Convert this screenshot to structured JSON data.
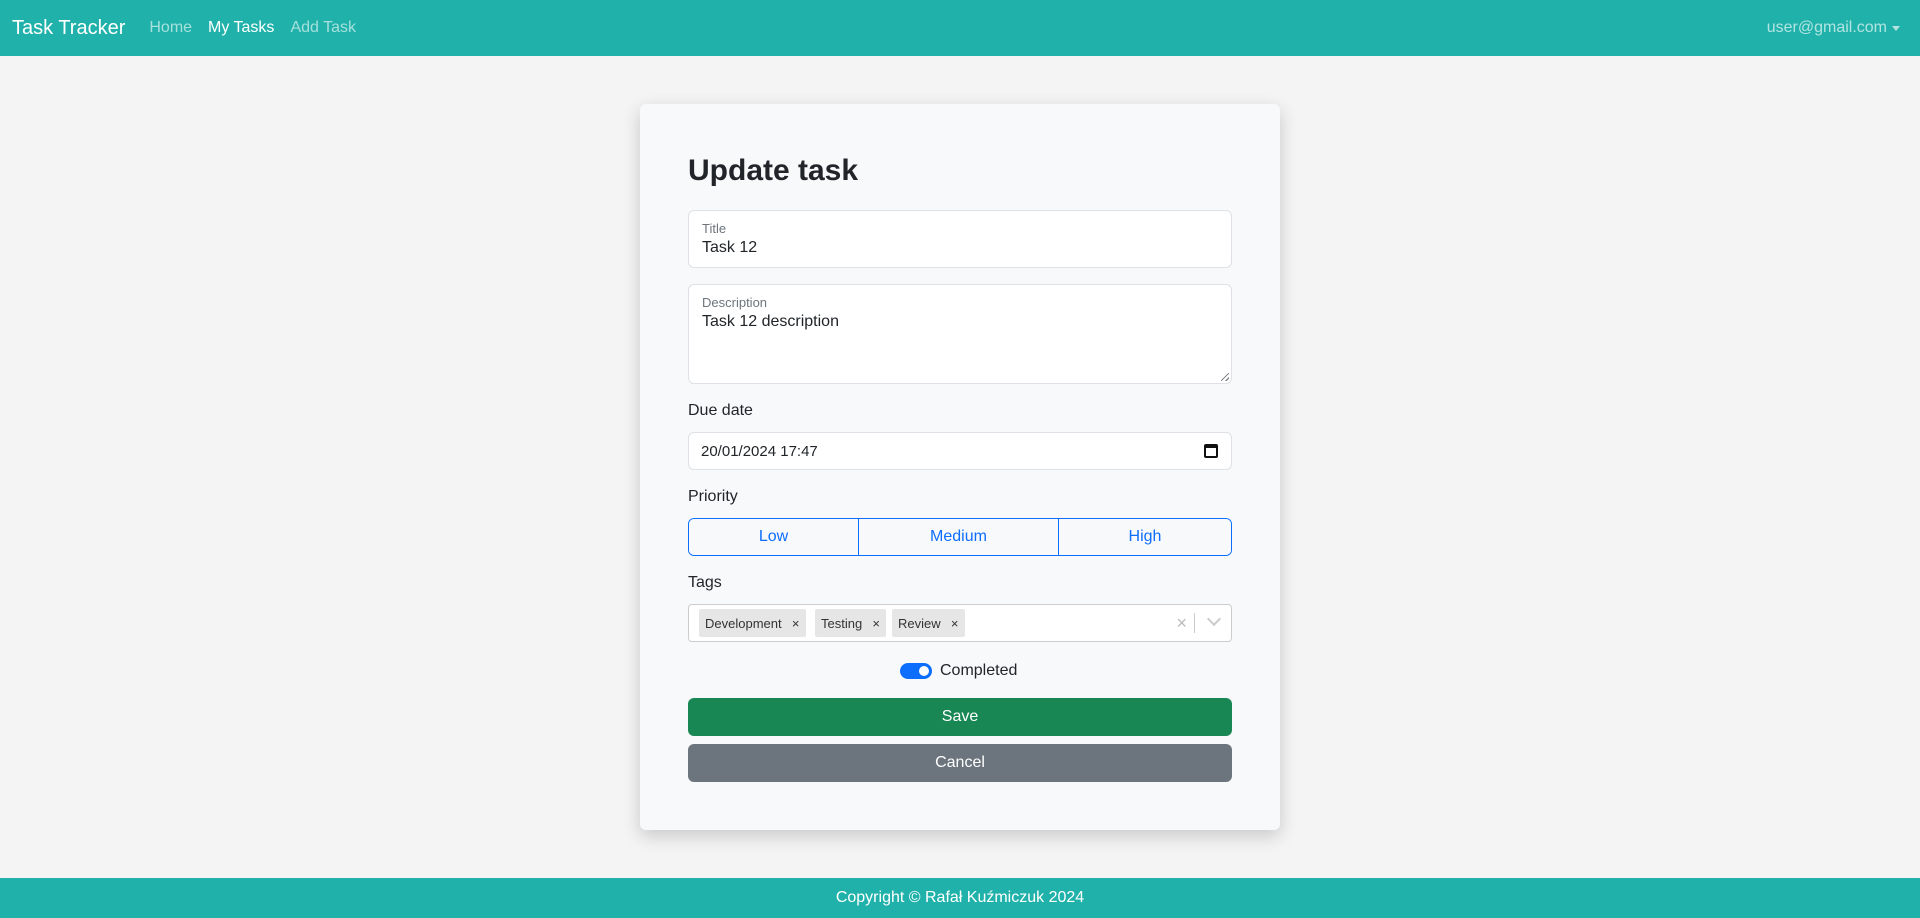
{
  "navbar": {
    "brand": "Task Tracker",
    "links": [
      {
        "label": "Home"
      },
      {
        "label": "My Tasks"
      },
      {
        "label": "Add Task"
      }
    ],
    "user": "user@gmail.com"
  },
  "form": {
    "heading": "Update task",
    "title": {
      "label": "Title",
      "value": "Task 12"
    },
    "description": {
      "label": "Description",
      "value": "Task 12 description"
    },
    "due_date": {
      "label": "Due date",
      "value": "20/01/2024 17:47"
    },
    "priority": {
      "label": "Priority",
      "options": [
        "Low",
        "Medium",
        "High"
      ]
    },
    "tags": {
      "label": "Tags",
      "selected": [
        "Development",
        "Testing",
        "Review"
      ],
      "clear_symbol": "×",
      "remove_symbol": "×"
    },
    "completed": {
      "label": "Completed",
      "checked": true
    },
    "save_label": "Save",
    "cancel_label": "Cancel"
  },
  "colors": {
    "navbar": "#20b2aa",
    "primary": "#0d6efd",
    "success": "#198754",
    "secondary": "#6c757d"
  },
  "footer": {
    "text": "Copyright © Rafał Kuźmiczuk 2024"
  }
}
